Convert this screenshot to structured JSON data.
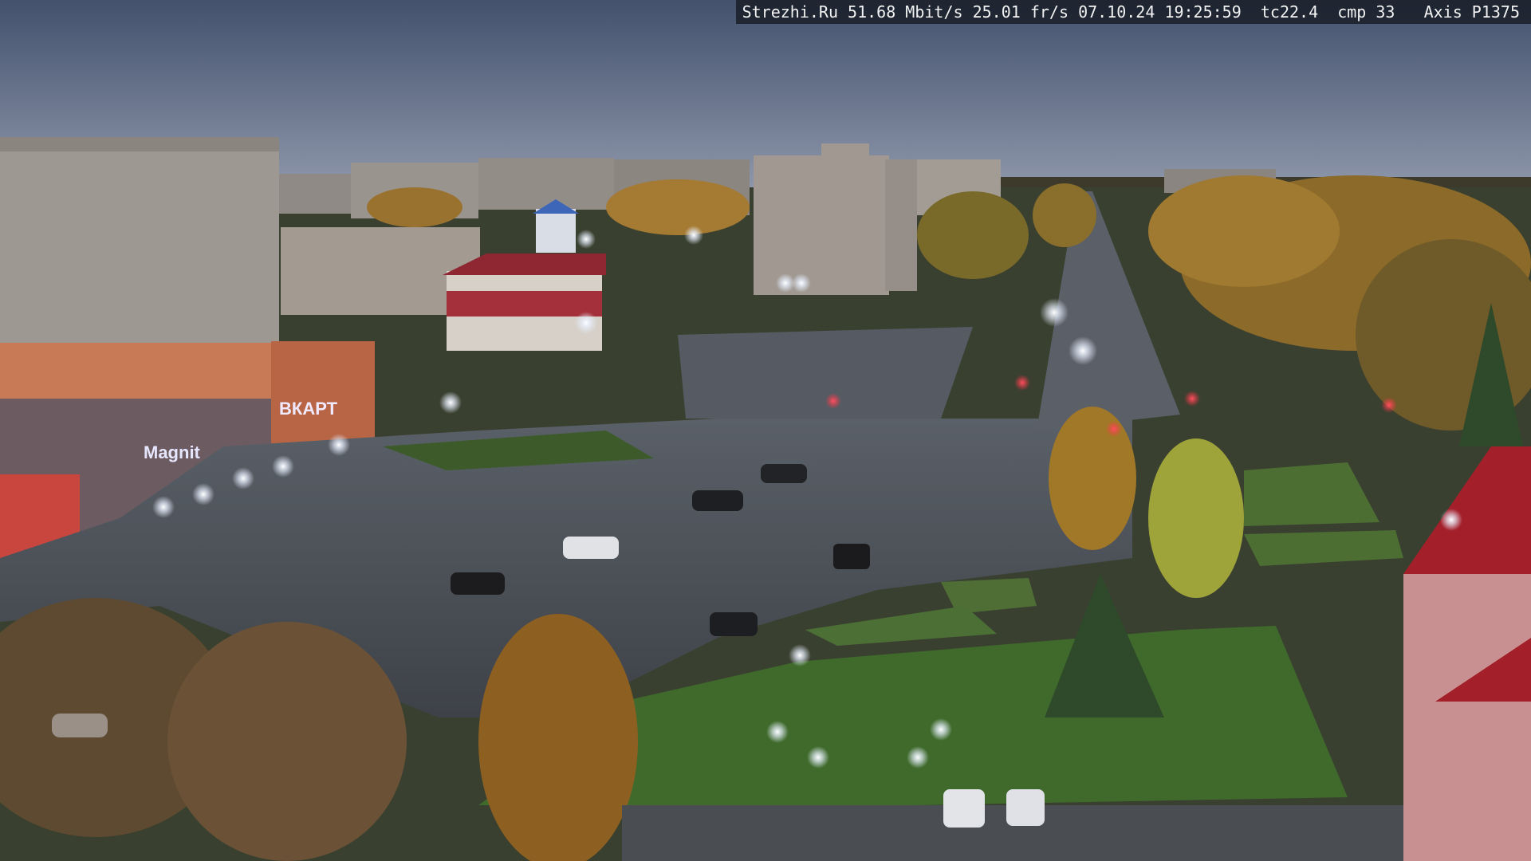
{
  "overlay": {
    "site": "Strezhi.Ru",
    "bitrate": "51.68 Mbit/s",
    "framerate": "25.01 fr/s",
    "date": "07.10.24",
    "time": "19:25:59",
    "tc": "tc22.4",
    "cmp": "cmp 33",
    "camera": "Axis P1375"
  },
  "signage": {
    "store_sign": "Magnit",
    "cyrillic_sign": "ВКАРТ"
  },
  "colors": {
    "sky_top": "#4a5a78",
    "sky_horizon": "#8a93a8",
    "asphalt": "#4b5058",
    "grass": "#3f6a2c",
    "autumn_foliage": "#b07a2a"
  }
}
